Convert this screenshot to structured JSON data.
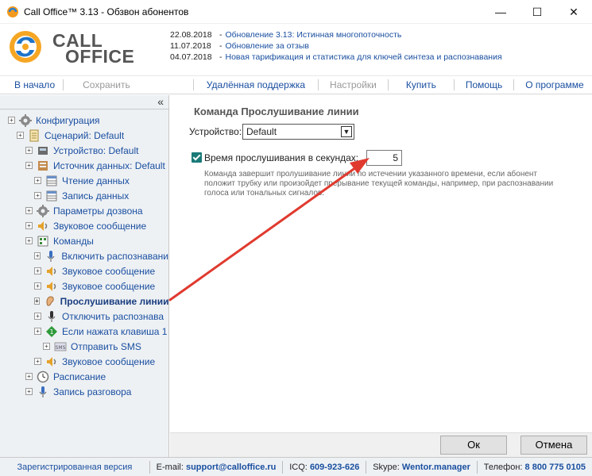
{
  "window": {
    "title": "Call Office™ 3.13 - Обзвон абонентов",
    "minimize": "—",
    "maximize": "☐",
    "close": "✕"
  },
  "logo": {
    "line1": "CALL",
    "line2": "OFFICE"
  },
  "news": [
    {
      "date": "22.08.2018",
      "text": "Обновление 3.13: Истинная многопоточность"
    },
    {
      "date": "11.07.2018",
      "text": "Обновление за отзыв"
    },
    {
      "date": "04.07.2018",
      "text": "Новая тарификация и статистика для ключей синтеза и распознавания"
    }
  ],
  "menu": {
    "home": "В начало",
    "save": "Сохранить",
    "remote": "Удалённая поддержка",
    "settings": "Настройки",
    "buy": "Купить",
    "help": "Помощь",
    "about": "О программе"
  },
  "tree": {
    "collapse": "«",
    "items": [
      {
        "label": "Конфигурация",
        "indent": 0,
        "icon": "gear-icon"
      },
      {
        "label": "Сценарий: Default",
        "indent": 1,
        "icon": "document-icon"
      },
      {
        "label": "Устройство: Default",
        "indent": 2,
        "icon": "device-icon"
      },
      {
        "label": "Источник данных: Default",
        "indent": 2,
        "icon": "database-icon"
      },
      {
        "label": "Чтение данных",
        "indent": 3,
        "icon": "table-icon"
      },
      {
        "label": "Запись данных",
        "indent": 3,
        "icon": "table-icon"
      },
      {
        "label": "Параметры дозвона",
        "indent": 2,
        "icon": "gear-icon"
      },
      {
        "label": "Звуковое сообщение",
        "indent": 2,
        "icon": "speaker-icon"
      },
      {
        "label": "Команды",
        "indent": 2,
        "icon": "commands-icon"
      },
      {
        "label": "Включить распознавани",
        "indent": 3,
        "icon": "mic-icon"
      },
      {
        "label": "Звуковое сообщение",
        "indent": 3,
        "icon": "speaker-icon"
      },
      {
        "label": "Звуковое сообщение",
        "indent": 3,
        "icon": "speaker-icon"
      },
      {
        "label": "Прослушивание линии",
        "indent": 3,
        "icon": "ear-icon",
        "bold": true
      },
      {
        "label": "Отключить распознава",
        "indent": 3,
        "icon": "mic-off-icon"
      },
      {
        "label": "Если нажата клавиша 1",
        "indent": 3,
        "icon": "key-icon"
      },
      {
        "label": "Отправить SMS",
        "indent": 4,
        "icon": "sms-icon"
      },
      {
        "label": "Звуковое сообщение",
        "indent": 3,
        "icon": "speaker-icon"
      },
      {
        "label": "Расписание",
        "indent": 2,
        "icon": "clock-icon"
      },
      {
        "label": "Запись разговора",
        "indent": 2,
        "icon": "mic-icon"
      }
    ]
  },
  "command": {
    "title": "Команда Прослушивание линии",
    "device_label": "Устройство:",
    "device_value": "Default",
    "checkbox_label": "Время прослушивания в секундах:",
    "seconds": "5",
    "description": "Команда завершит пролушивание линии по истечении указанного времени, если абонент положит трубку или произойдет прерывание текущей команды, например, при распознавании голоса или тональных сигналов."
  },
  "buttons": {
    "ok": "Ок",
    "cancel": "Отмена"
  },
  "status": {
    "registered": "Зарегистрированная версия",
    "email_label": "E-mail:",
    "email": "support@calloffice.ru",
    "icq_label": "ICQ:",
    "icq": "609-923-626",
    "skype_label": "Skype:",
    "skype": "Wentor.manager",
    "phone_label": "Телефон:",
    "phone": "8 800 775 0105"
  },
  "colors": {
    "accent": "#1a4fa0",
    "arrow": "#e03a2f",
    "checkbox": "#1a7a78"
  }
}
